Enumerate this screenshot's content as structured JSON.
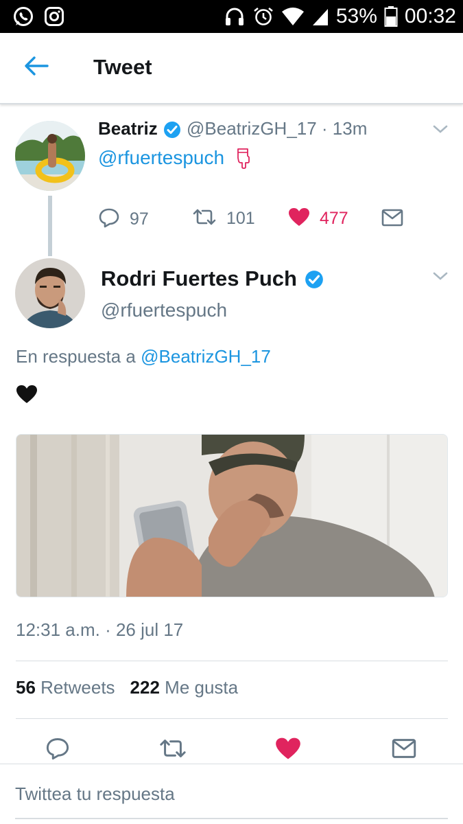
{
  "status_bar": {
    "battery": "53%",
    "time": "00:32",
    "left_icons": [
      "whatsapp-icon",
      "instagram-icon"
    ],
    "right_icons": [
      "headphones-icon",
      "alarm-icon",
      "wifi-icon",
      "signal-icon",
      "battery-icon"
    ]
  },
  "header": {
    "title": "Tweet"
  },
  "parent_tweet": {
    "name": "Beatriz",
    "handle_time": "@BeatrizGH_17 · 13m",
    "text": "@rfuertespuch",
    "emoji": "pointing-down-hand",
    "actions": {
      "replies": "97",
      "retweets": "101",
      "likes": "477"
    }
  },
  "main_tweet": {
    "name": "Rodri Fuertes Puch",
    "handle": "@rfuertespuch",
    "reply_prefix": "En respuesta a",
    "reply_to": "@BeatrizGH_17",
    "text_emoji": "black-heart",
    "timestamp": "12:31 a.m. · 26 jul 17",
    "retweets_count": "56",
    "retweets_label": "Retweets",
    "likes_count": "222",
    "likes_label": "Me gusta"
  },
  "reply_box": {
    "placeholder": "Twittea tu respuesta"
  },
  "colors": {
    "accent": "#1b95e0",
    "like": "#e0245e",
    "muted": "#657786",
    "verified": "#1da1f2"
  }
}
